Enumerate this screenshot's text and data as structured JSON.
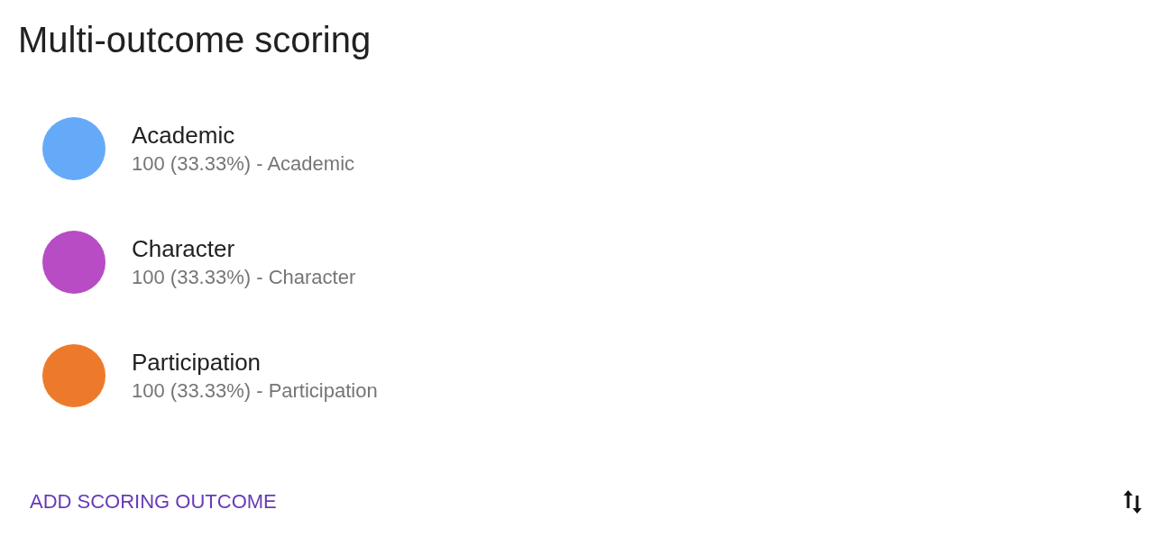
{
  "title": "Multi-outcome scoring",
  "outcomes": [
    {
      "name": "Academic",
      "detail": "100 (33.33%) - Academic",
      "color": "#64aaf8"
    },
    {
      "name": "Character",
      "detail": "100 (33.33%) - Character",
      "color": "#b84cc4"
    },
    {
      "name": "Participation",
      "detail": "100 (33.33%) - Participation",
      "color": "#ed7a2a"
    }
  ],
  "add_button": "ADD SCORING OUTCOME"
}
